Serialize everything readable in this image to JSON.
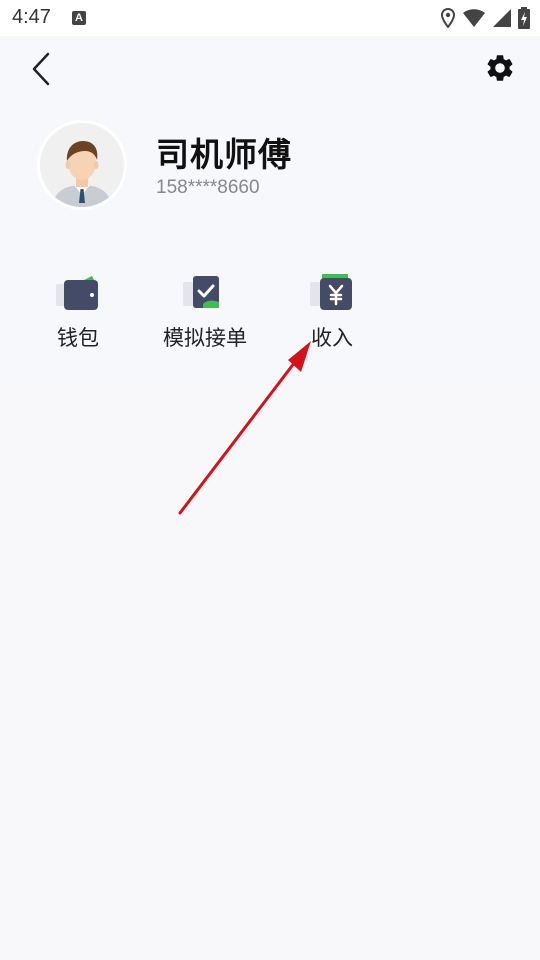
{
  "status_bar": {
    "time": "4:47",
    "icons": [
      "a-notification-icon",
      "location-icon",
      "wifi-icon",
      "signal-icon",
      "battery-charging-icon"
    ]
  },
  "header": {
    "back_icon": "chevron-left-icon",
    "settings_icon": "gear-icon"
  },
  "profile": {
    "avatar_icon": "driver-avatar",
    "name": "司机师傅",
    "phone": "158****8660"
  },
  "menu": {
    "items": [
      {
        "label": "钱包",
        "icon": "wallet-icon"
      },
      {
        "label": "模拟接单",
        "icon": "mock-order-icon"
      },
      {
        "label": "收入",
        "icon": "income-icon"
      }
    ]
  },
  "colors": {
    "icon_dark": "#434b66",
    "icon_accent": "#3dbd54",
    "annotation_arrow": "#d4121c",
    "header_bg": "#f7f8fc",
    "page_bg": "#f8f8fa"
  }
}
